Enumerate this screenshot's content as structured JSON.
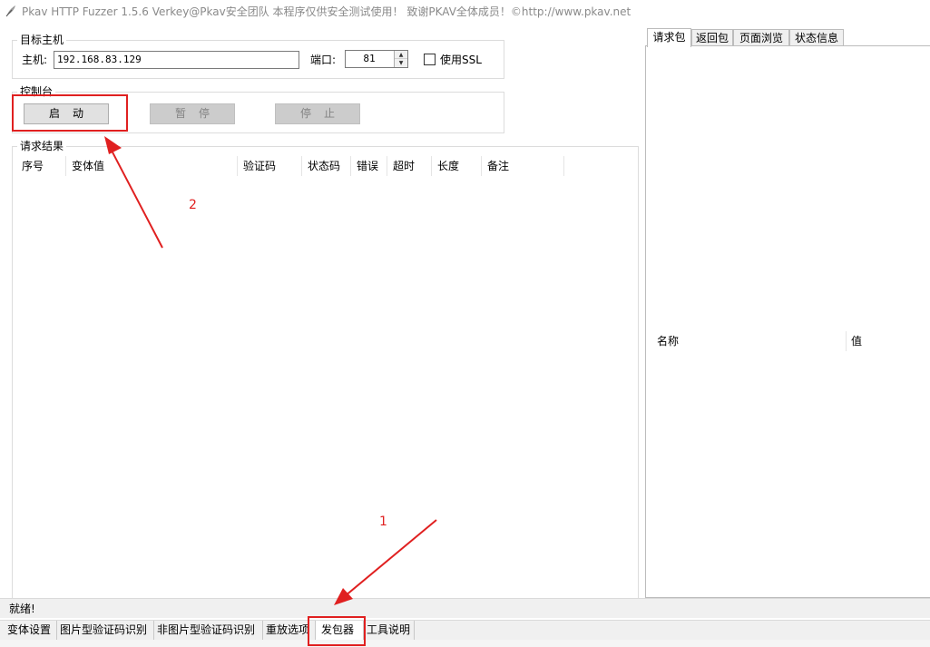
{
  "window": {
    "title": "Pkav HTTP Fuzzer 1.5.6  Verkey@Pkav安全团队  本程序仅供安全测试使用！ 致谢PKAV全体成员！©http://www.pkav.net"
  },
  "target_host": {
    "legend": "目标主机",
    "host_label": "主机:",
    "host_value": "192.168.83.129",
    "port_label": "端口:",
    "port_value": "81",
    "ssl_label": "使用SSL",
    "ssl_checked": false
  },
  "console": {
    "legend": "控制台",
    "start_label": "启动",
    "pause_label": "暂停",
    "stop_label": "停止"
  },
  "results": {
    "legend": "请求结果",
    "columns": [
      "序号",
      "变体值",
      "验证码",
      "状态码",
      "错误",
      "超时",
      "长度",
      "备注"
    ],
    "rows": []
  },
  "right_tabs": [
    "请求包",
    "返回包",
    "页面浏览",
    "状态信息"
  ],
  "right_table": {
    "columns": [
      "名称",
      "值"
    ]
  },
  "status": {
    "text": "就绪!"
  },
  "bottom_tabs": [
    "变体设置",
    "图片型验证码识别",
    "非图片型验证码识别",
    "重放选项",
    "发包器",
    "工具说明"
  ],
  "active_bottom_tab": "发包器",
  "annotations": {
    "marker_1": "1",
    "marker_2": "2",
    "color": "#e02020"
  }
}
